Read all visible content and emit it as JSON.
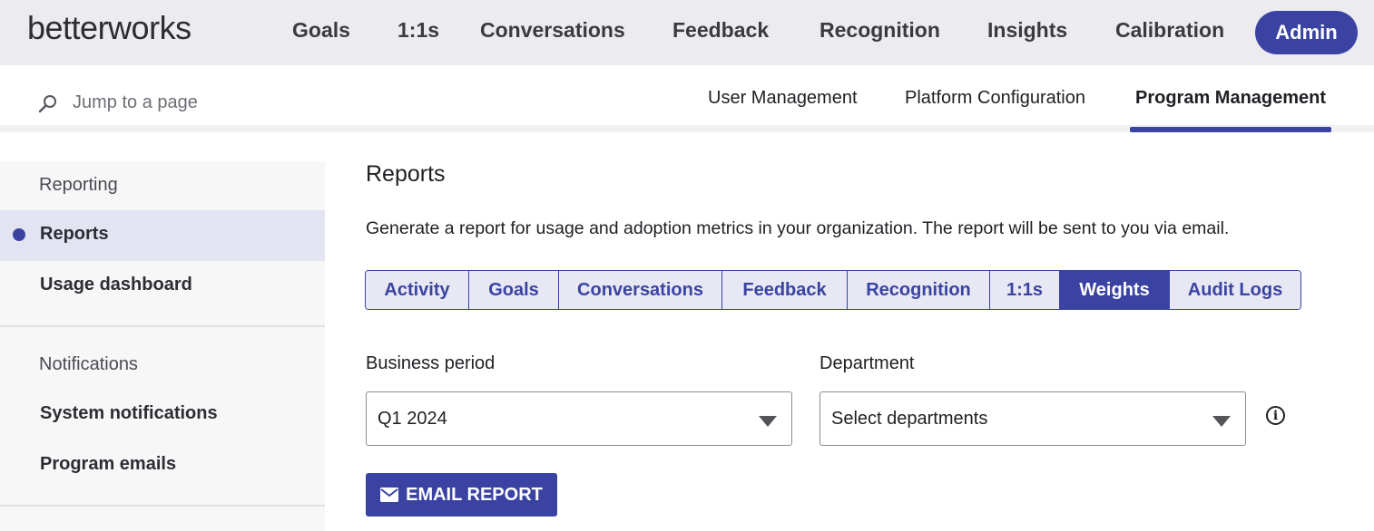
{
  "brand": {
    "logo_text": "betterworks"
  },
  "top_nav": {
    "items": [
      "Goals",
      "1:1s",
      "Conversations",
      "Feedback",
      "Recognition",
      "Insights",
      "Calibration"
    ],
    "active_item": "Admin"
  },
  "search": {
    "placeholder": "Jump to a page",
    "icon": "search-icon"
  },
  "sub_nav": {
    "items": [
      "User Management",
      "Platform Configuration",
      "Program Management"
    ],
    "active": "Program Management"
  },
  "sidebar": {
    "sections": [
      {
        "heading": "Reporting",
        "items": [
          "Reports",
          "Usage dashboard"
        ]
      },
      {
        "heading": "Notifications",
        "items": [
          "System notifications",
          "Program emails"
        ]
      }
    ],
    "active_item": "Reports"
  },
  "main": {
    "title": "Reports",
    "description": "Generate a report for usage and adoption metrics in your organization. The report will be sent to you via email.",
    "tabs": [
      "Activity",
      "Goals",
      "Conversations",
      "Feedback",
      "Recognition",
      "1:1s",
      "Weights",
      "Audit Logs"
    ],
    "active_tab": "Weights",
    "business_period": {
      "label": "Business period",
      "value": "Q1 2024"
    },
    "department": {
      "label": "Department",
      "placeholder": "Select departments"
    },
    "info_icon": "info-icon",
    "email_button": {
      "label": "EMAIL REPORT",
      "icon": "mail-icon"
    }
  },
  "colors": {
    "accent": "#3a43a2",
    "topbar_bg": "#ebebf0",
    "sidebar_bg": "#f7f7f8",
    "active_item_bg": "#e3e4f1"
  }
}
